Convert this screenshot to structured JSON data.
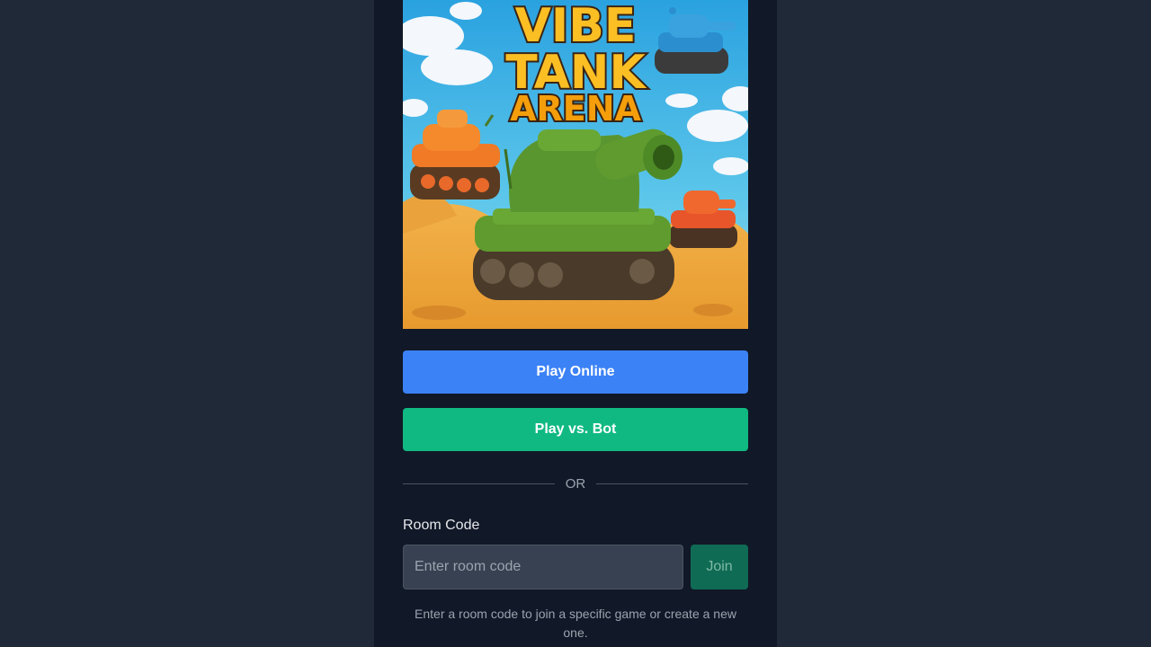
{
  "hero": {
    "title_line1": "VIBE",
    "title_line2": "TANK",
    "title_line3": "ARENA"
  },
  "buttons": {
    "play_online": "Play Online",
    "play_bot": "Play vs. Bot",
    "join": "Join"
  },
  "divider": {
    "label": "OR"
  },
  "room": {
    "label": "Room Code",
    "placeholder": "Enter room code",
    "value": "",
    "help": "Enter a room code to join a specific game or create a new one."
  },
  "colors": {
    "background": "#1f2937",
    "panel": "#111827",
    "play_online": "#3b82f6",
    "play_bot": "#10b981",
    "join": "#0f6b54",
    "input": "#374151"
  }
}
